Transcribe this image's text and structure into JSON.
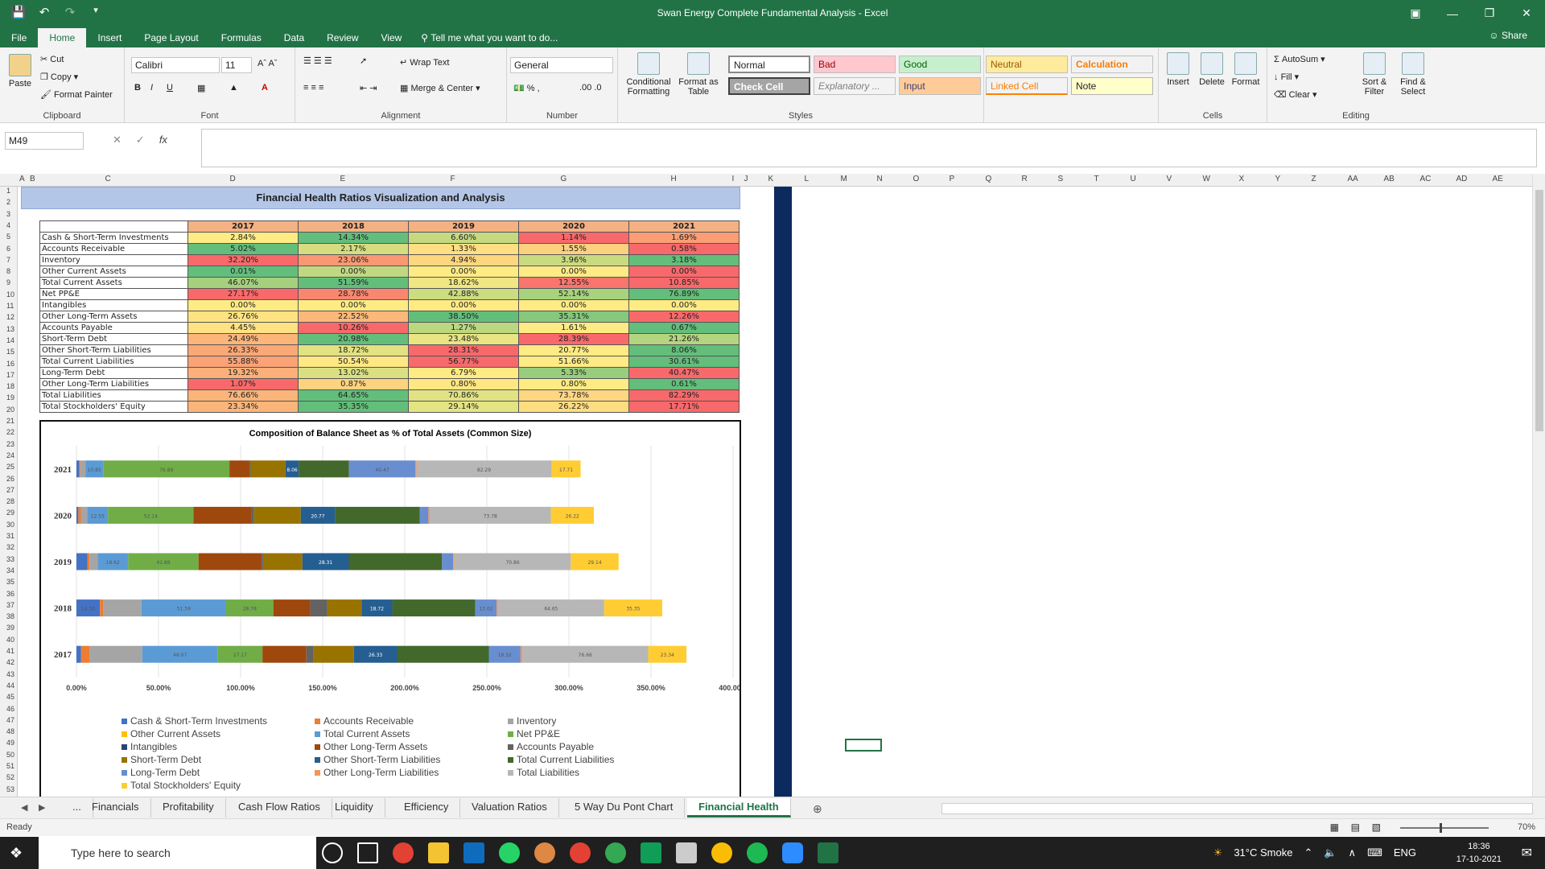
{
  "window": {
    "title": "Swan Energy Complete Fundamental Analysis - Excel",
    "share_label": "Share"
  },
  "ribbon_tabs": [
    "File",
    "Home",
    "Insert",
    "Page Layout",
    "Formulas",
    "Data",
    "Review",
    "View"
  ],
  "tell_me": "Tell me what you want to do...",
  "clipboard": {
    "paste": "Paste",
    "cut": "Cut",
    "copy": "Copy",
    "format_painter": "Format Painter",
    "label": "Clipboard"
  },
  "font": {
    "name": "Calibri",
    "size": "11",
    "label": "Font"
  },
  "alignment": {
    "wrap": "Wrap Text",
    "merge": "Merge & Center",
    "label": "Alignment"
  },
  "number": {
    "format": "General",
    "label": "Number"
  },
  "styles": {
    "conditional": "Conditional Formatting",
    "format_table": "Format as Table",
    "normal": "Normal",
    "bad": "Bad",
    "good": "Good",
    "neutral": "Neutral",
    "calculation": "Calculation",
    "check": "Check Cell",
    "explanatory": "Explanatory ...",
    "input": "Input",
    "linked": "Linked Cell",
    "note": "Note",
    "label": "Styles"
  },
  "cells": {
    "insert": "Insert",
    "delete": "Delete",
    "format": "Format",
    "label": "Cells"
  },
  "editing": {
    "autosum": "AutoSum",
    "fill": "Fill",
    "clear": "Clear",
    "sort": "Sort & Filter",
    "find": "Find & Select",
    "label": "Editing"
  },
  "name_box": "M49",
  "columns": [
    "A",
    "B",
    "C",
    "D",
    "E",
    "F",
    "G",
    "H",
    "I",
    "J",
    "K",
    "L",
    "M",
    "N",
    "O",
    "P",
    "Q",
    "R",
    "S",
    "T",
    "U",
    "V",
    "W",
    "X",
    "Y",
    "Z",
    "AA",
    "AB",
    "AC",
    "AD",
    "AE"
  ],
  "sheet_title": "Financial Health Ratios Visualization and Analysis",
  "table": {
    "years": [
      "2017",
      "2018",
      "2019",
      "2020",
      "2021"
    ],
    "rows": [
      {
        "label": "Cash & Short-Term Investments",
        "values": [
          "2.84%",
          "14.34%",
          "6.60%",
          "1.14%",
          "1.69%"
        ]
      },
      {
        "label": "Accounts Receivable",
        "values": [
          "5.02%",
          "2.17%",
          "1.33%",
          "1.55%",
          "0.58%"
        ]
      },
      {
        "label": "Inventory",
        "values": [
          "32.20%",
          "23.06%",
          "4.94%",
          "3.96%",
          "3.18%"
        ]
      },
      {
        "label": "Other Current Assets",
        "values": [
          "0.01%",
          "0.00%",
          "0.00%",
          "0.00%",
          "0.00%"
        ]
      },
      {
        "label": "Total Current Assets",
        "values": [
          "46.07%",
          "51.59%",
          "18.62%",
          "12.55%",
          "10.85%"
        ]
      },
      {
        "label": "Net PP&E",
        "values": [
          "27.17%",
          "28.78%",
          "42.88%",
          "52.14%",
          "76.89%"
        ]
      },
      {
        "label": "Intangibles",
        "values": [
          "0.00%",
          "0.00%",
          "0.00%",
          "0.00%",
          "0.00%"
        ]
      },
      {
        "label": "Other Long-Term Assets",
        "values": [
          "26.76%",
          "22.52%",
          "38.50%",
          "35.31%",
          "12.26%"
        ]
      },
      {
        "label": "Accounts Payable",
        "values": [
          "4.45%",
          "10.26%",
          "1.27%",
          "1.61%",
          "0.67%"
        ]
      },
      {
        "label": "Short-Term Debt",
        "values": [
          "24.49%",
          "20.98%",
          "23.48%",
          "28.39%",
          "21.26%"
        ]
      },
      {
        "label": "Other Short-Term Liabilities",
        "values": [
          "26.33%",
          "18.72%",
          "28.31%",
          "20.77%",
          "8.06%"
        ]
      },
      {
        "label": "Total Current Liabilities",
        "values": [
          "55.88%",
          "50.54%",
          "56.77%",
          "51.66%",
          "30.61%"
        ]
      },
      {
        "label": "Long-Term Debt",
        "values": [
          "19.32%",
          "13.02%",
          "6.79%",
          "5.33%",
          "40.47%"
        ]
      },
      {
        "label": "Other Long-Term Liabilities",
        "values": [
          "1.07%",
          "0.87%",
          "0.80%",
          "0.80%",
          "0.61%"
        ]
      },
      {
        "label": "Total Liabilities",
        "values": [
          "76.66%",
          "64.65%",
          "70.86%",
          "73.78%",
          "82.29%"
        ]
      },
      {
        "label": "Total Stockholders' Equity",
        "values": [
          "23.34%",
          "35.35%",
          "29.14%",
          "26.22%",
          "17.71%"
        ]
      }
    ],
    "cell_colors": [
      [
        "#ffeb84",
        "#63be7b",
        "#c5da80",
        "#f8696b",
        "#fb9e75"
      ],
      [
        "#63be7b",
        "#d6dd81",
        "#ffdf82",
        "#fbd17f",
        "#f8696b"
      ],
      [
        "#f8696b",
        "#fa9874",
        "#fdd680",
        "#c9db80",
        "#63be7b"
      ],
      [
        "#63be7b",
        "#c0d980",
        "#ffeb84",
        "#ffeb84",
        "#f8696b"
      ],
      [
        "#a5d17e",
        "#63be7b",
        "#f0e683",
        "#f9766e",
        "#f8696b"
      ],
      [
        "#f8696b",
        "#f98770",
        "#ccdc81",
        "#a7d27e",
        "#63be7b"
      ],
      [
        "#ffeb84",
        "#ffeb84",
        "#ffeb84",
        "#ffeb84",
        "#ffeb84"
      ],
      [
        "#ffe282",
        "#fcb87a",
        "#63be7b",
        "#86c87d",
        "#f8696b"
      ],
      [
        "#ffe283",
        "#f8696b",
        "#bbd880",
        "#ffeb84",
        "#63be7b"
      ],
      [
        "#fcb67a",
        "#63be7b",
        "#e9e583",
        "#f8696b",
        "#b4d57f"
      ],
      [
        "#fba877",
        "#e2e282",
        "#f8696b",
        "#ffeb84",
        "#63be7b"
      ],
      [
        "#fba276",
        "#ffe883",
        "#f8696b",
        "#ffeb84",
        "#63be7b"
      ],
      [
        "#fcaf78",
        "#dae082",
        "#ffeb84",
        "#99cd7e",
        "#f8696b"
      ],
      [
        "#f8696b",
        "#fed380",
        "#ffe783",
        "#ffeb84",
        "#63be7b"
      ],
      [
        "#fbb47a",
        "#63be7b",
        "#e1e283",
        "#fed781",
        "#f8696b"
      ],
      [
        "#fbb57a",
        "#63be7b",
        "#e4e483",
        "#fedd81",
        "#f8696b"
      ]
    ]
  },
  "chart_data": {
    "type": "bar",
    "orientation": "horizontal-stacked",
    "title": "Composition of Balance Sheet as % of Total Assets (Common Size)",
    "categories": [
      "2021",
      "2020",
      "2019",
      "2018",
      "2017"
    ],
    "xlim": [
      0,
      400
    ],
    "x_ticks": [
      "0.00%",
      "50.00%",
      "100.00%",
      "150.00%",
      "200.00%",
      "250.00%",
      "300.00%",
      "350.00%",
      "400.00%"
    ],
    "legend_position": "bottom",
    "series": [
      {
        "name": "Cash & Short-Term Investments",
        "color": "#4472c4",
        "values": [
          1.69,
          1.14,
          6.6,
          14.34,
          2.84
        ]
      },
      {
        "name": "Accounts Receivable",
        "color": "#ed7d31",
        "values": [
          0.58,
          1.55,
          1.33,
          2.17,
          5.02
        ]
      },
      {
        "name": "Inventory",
        "color": "#a5a5a5",
        "values": [
          3.18,
          3.96,
          4.94,
          23.06,
          32.2
        ]
      },
      {
        "name": "Other Current Assets",
        "color": "#ffc000",
        "values": [
          0,
          0,
          0,
          0,
          0.01
        ]
      },
      {
        "name": "Total Current Assets",
        "color": "#5b9bd5",
        "values": [
          10.85,
          12.55,
          18.62,
          51.59,
          46.07
        ]
      },
      {
        "name": "Net PP&E",
        "color": "#70ad47",
        "values": [
          76.89,
          52.14,
          42.88,
          28.78,
          27.17
        ]
      },
      {
        "name": "Intangibles",
        "color": "#264478",
        "values": [
          0,
          0,
          0,
          0,
          0
        ]
      },
      {
        "name": "Other Long-Term Assets",
        "color": "#9e480e",
        "values": [
          12.26,
          35.31,
          38.5,
          22.52,
          26.76
        ]
      },
      {
        "name": "Accounts Payable",
        "color": "#636363",
        "values": [
          0.67,
          1.61,
          1.27,
          10.26,
          4.45
        ]
      },
      {
        "name": "Short-Term Debt",
        "color": "#997300",
        "values": [
          21.26,
          28.39,
          23.48,
          20.98,
          24.49
        ]
      },
      {
        "name": "Other Short-Term Liabilities",
        "color": "#255e91",
        "values": [
          8.06,
          20.77,
          28.31,
          18.72,
          26.33
        ]
      },
      {
        "name": "Total Current Liabilities",
        "color": "#43682b",
        "values": [
          30.61,
          51.66,
          56.77,
          50.54,
          55.88
        ]
      },
      {
        "name": "Long-Term Debt",
        "color": "#698ed0",
        "values": [
          40.47,
          5.33,
          6.79,
          13.02,
          19.32
        ]
      },
      {
        "name": "Other Long-Term Liabilities",
        "color": "#f1975a",
        "values": [
          0.61,
          0.8,
          0.8,
          0.87,
          1.07
        ]
      },
      {
        "name": "Total Liabilities",
        "color": "#b7b7b7",
        "values": [
          82.29,
          73.78,
          70.86,
          64.65,
          76.66
        ]
      },
      {
        "name": "Total Stockholders' Equity",
        "color": "#ffcd33",
        "values": [
          17.71,
          26.22,
          29.14,
          35.35,
          23.34
        ]
      }
    ],
    "labeled_series": [
      0,
      4,
      5,
      10,
      12,
      14,
      15
    ]
  },
  "sheet_tabs": [
    "...",
    "Financials",
    "Profitability",
    "Cash Flow Ratios",
    "Liquidity",
    "Efficiency",
    "Valuation Ratios",
    "5 Way Du Pont Chart",
    "Financial Health"
  ],
  "status": {
    "ready": "Ready",
    "zoom": "70%"
  },
  "taskbar": {
    "search_placeholder": "Type here to search",
    "weather": "31°C  Smoke",
    "lang": "ENG",
    "time": "18:36",
    "date": "17-10-2021"
  }
}
